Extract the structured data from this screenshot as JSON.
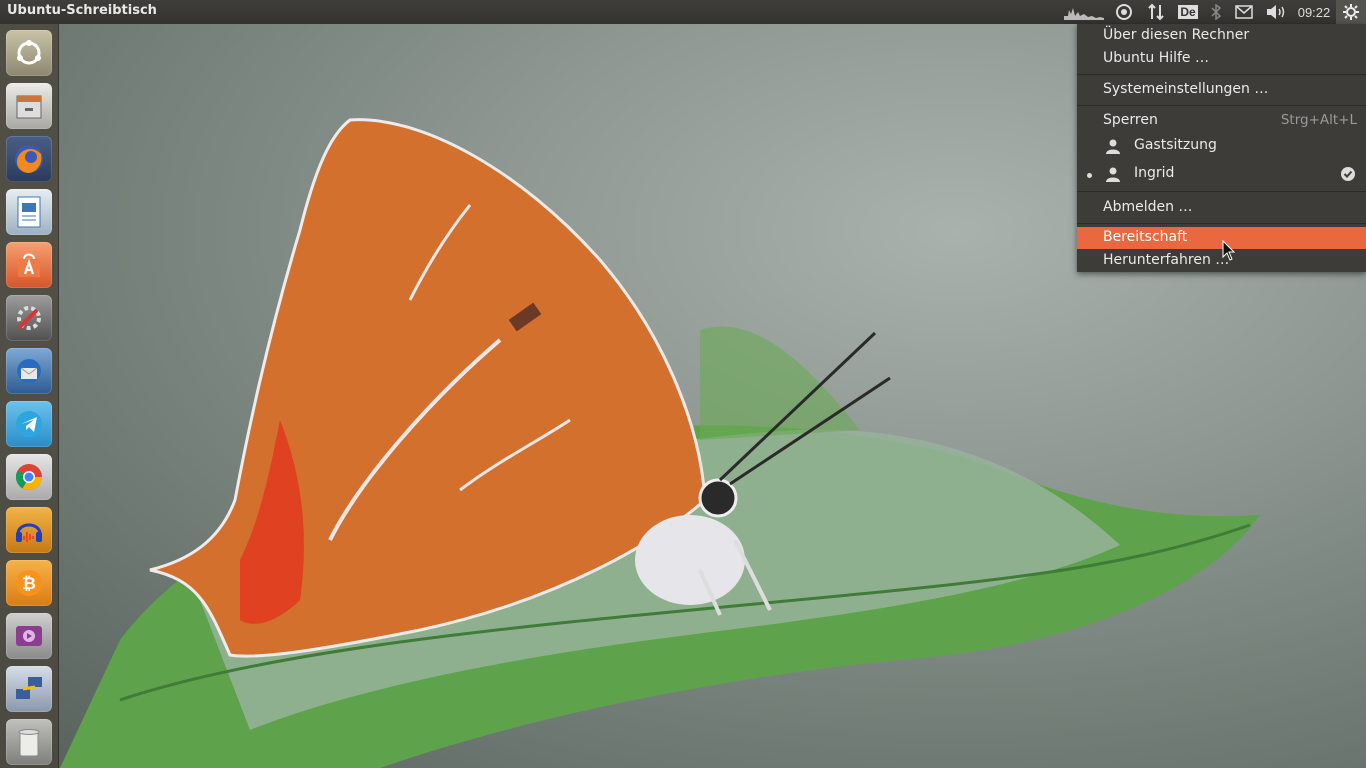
{
  "panel": {
    "title": "Ubuntu-Schreibtisch",
    "keyboard_layout": "De",
    "clock": "09:22"
  },
  "indicators": [
    "system-monitor-icon",
    "ubuntu-one-icon",
    "network-icon",
    "keyboard-layout-icon",
    "bluetooth-icon",
    "mail-icon",
    "volume-icon",
    "gear-icon"
  ],
  "launcher": {
    "items": [
      {
        "name": "dash-home",
        "icon": "ubuntu-logo-icon"
      },
      {
        "name": "files",
        "icon": "file-cabinet-icon"
      },
      {
        "name": "firefox",
        "icon": "firefox-icon"
      },
      {
        "name": "libreoffice-writer",
        "icon": "writer-document-icon"
      },
      {
        "name": "software-center",
        "icon": "shopping-bag-icon"
      },
      {
        "name": "system-settings",
        "icon": "settings-wrench-icon"
      },
      {
        "name": "thunderbird",
        "icon": "thunderbird-icon"
      },
      {
        "name": "telegram",
        "icon": "telegram-icon"
      },
      {
        "name": "chrome",
        "icon": "chrome-icon"
      },
      {
        "name": "audacity",
        "icon": "headphones-icon"
      },
      {
        "name": "bitcoin",
        "icon": "bitcoin-icon"
      },
      {
        "name": "media-player",
        "icon": "video-player-icon"
      },
      {
        "name": "remote-desktop",
        "icon": "remote-network-icon"
      },
      {
        "name": "trash",
        "icon": "trash-icon"
      }
    ]
  },
  "session_menu": {
    "about": "Über diesen Rechner",
    "help": "Ubuntu Hilfe …",
    "settings": "Systemeinstellungen …",
    "lock": "Sperren",
    "lock_shortcut": "Strg+Alt+L",
    "guest": "Gastsitzung",
    "user": "Ingrid",
    "logout": "Abmelden …",
    "suspend": "Bereitschaft",
    "shutdown": "Herunterfahren …"
  },
  "colors": {
    "highlight": "#e9683f",
    "panel": "#3f3e3a",
    "menu_bg": "#3d3c38"
  }
}
